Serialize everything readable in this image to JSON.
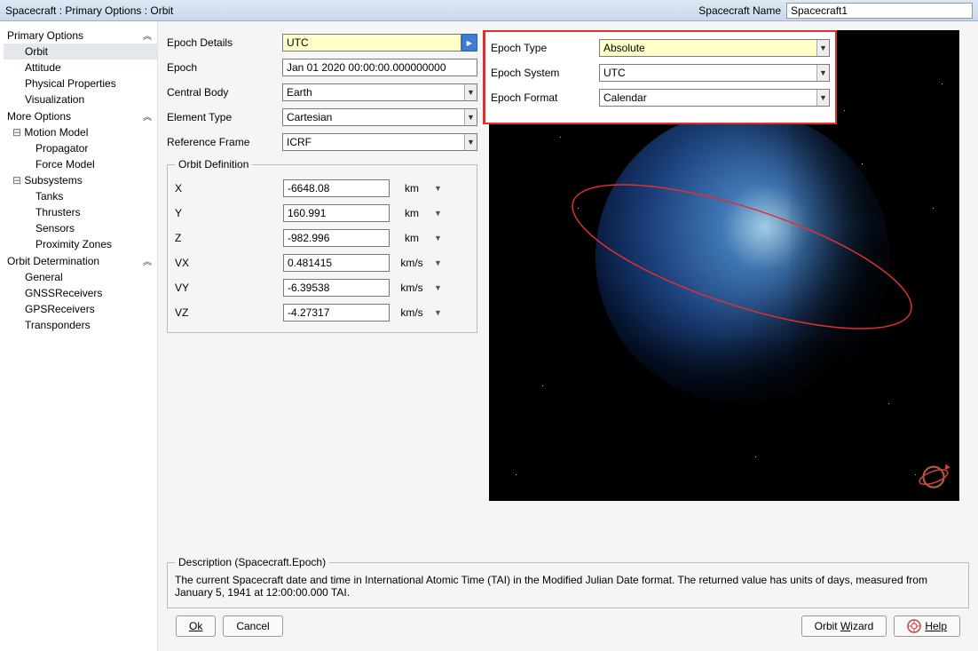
{
  "titlebar": {
    "breadcrumb": "Spacecraft : Primary Options : Orbit",
    "name_label": "Spacecraft Name",
    "name_value": "Spacecraft1"
  },
  "sidebar": {
    "primary": {
      "label": "Primary Options",
      "items": [
        "Orbit",
        "Attitude",
        "Physical Properties",
        "Visualization"
      ]
    },
    "more": {
      "label": "More Options"
    },
    "motion": {
      "label": "Motion Model",
      "items": [
        "Propagator",
        "Force Model"
      ]
    },
    "subsystems": {
      "label": "Subsystems",
      "items": [
        "Tanks",
        "Thrusters",
        "Sensors",
        "Proximity Zones"
      ]
    },
    "orbitdet": {
      "label": "Orbit Determination",
      "items": [
        "General",
        "GNSSReceivers",
        "GPSReceivers",
        "Transponders"
      ]
    }
  },
  "form": {
    "epoch_details_label": "Epoch Details",
    "epoch_details_value": "UTC",
    "epoch_label": "Epoch",
    "epoch_value": "Jan 01 2020 00:00:00.000000000",
    "central_body_label": "Central Body",
    "central_body_value": "Earth",
    "element_type_label": "Element Type",
    "element_type_value": "Cartesian",
    "ref_frame_label": "Reference Frame",
    "ref_frame_value": "ICRF"
  },
  "popup": {
    "type_label": "Epoch Type",
    "type_value": "Absolute",
    "system_label": "Epoch System",
    "system_value": "UTC",
    "format_label": "Epoch Format",
    "format_value": "Calendar"
  },
  "orbit_def": {
    "legend": "Orbit Definition",
    "rows": [
      {
        "label": "X",
        "value": "-6648.08",
        "unit": "km"
      },
      {
        "label": "Y",
        "value": "160.991",
        "unit": "km"
      },
      {
        "label": "Z",
        "value": "-982.996",
        "unit": "km"
      },
      {
        "label": "VX",
        "value": "0.481415",
        "unit": "km/s"
      },
      {
        "label": "VY",
        "value": "-6.39538",
        "unit": "km/s"
      },
      {
        "label": "VZ",
        "value": "-4.27317",
        "unit": "km/s"
      }
    ]
  },
  "description": {
    "legend": "Description (Spacecraft.Epoch)",
    "text": "The current Spacecraft date and time in International Atomic Time (TAI) in the Modified Julian Date format. The returned value has units of days, measured from January 5, 1941 at 12:00:00.000 TAI."
  },
  "buttons": {
    "ok": "Ok",
    "cancel": "Cancel",
    "wizard": "Orbit Wizard",
    "help": "Help"
  }
}
